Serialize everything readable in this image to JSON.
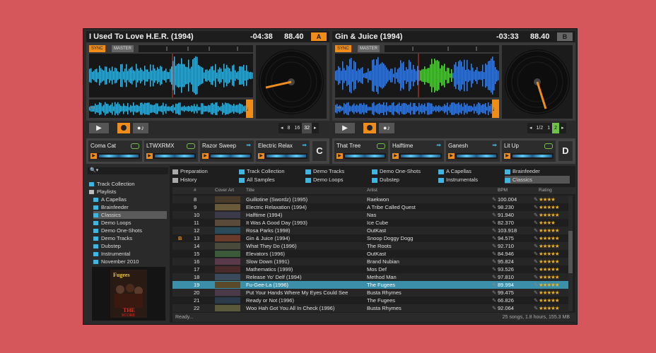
{
  "deckA": {
    "title": "I Used To Love H.E.R. (1994)",
    "time": "-04:38",
    "bpm": "88.40",
    "letter": "A",
    "sync": "SYNC",
    "master": "MASTER",
    "loops": [
      "8",
      "16",
      "32"
    ],
    "active_loop": "32",
    "play": "▶"
  },
  "deckB": {
    "title": "Gin & Juice (1994)",
    "time": "-03:33",
    "bpm": "88.40",
    "letter": "B",
    "sync": "SYNC",
    "master": "MASTER",
    "loops": [
      "1/2",
      "1",
      "2"
    ],
    "active_loop": "2",
    "play": "▶"
  },
  "fxA": {
    "slots": [
      "Coma Cat",
      "LTWXRMX",
      "Razor Sweep",
      "Electric Relax"
    ],
    "letter": "C"
  },
  "fxB": {
    "slots": [
      "That Tree",
      "Halftime",
      "Ganesh",
      "Lit Up"
    ],
    "letter": "D"
  },
  "tree": {
    "search": "🔍▾",
    "items": [
      {
        "label": "Track Collection",
        "icon": "track-collection-icon"
      },
      {
        "label": "Playlists",
        "icon": "folder-icon"
      },
      {
        "label": "A Capellas"
      },
      {
        "label": "Brainfeeder"
      },
      {
        "label": "Classics",
        "selected": true
      },
      {
        "label": "Demo Loops"
      },
      {
        "label": "Demo One-Shots"
      },
      {
        "label": "Demo Tracks"
      },
      {
        "label": "Dubstep"
      },
      {
        "label": "Instrumental"
      },
      {
        "label": "November 2010"
      }
    ]
  },
  "favorites": [
    {
      "label": "Preparation"
    },
    {
      "label": "Track Collection"
    },
    {
      "label": "Demo Tracks"
    },
    {
      "label": "Demo One-Shots"
    },
    {
      "label": "A Capellas"
    },
    {
      "label": "Brainfeeder"
    },
    {
      "label": "History"
    },
    {
      "label": "All Samples"
    },
    {
      "label": "Demo Loops"
    },
    {
      "label": "Dubstep"
    },
    {
      "label": "Instrumentals"
    },
    {
      "label": "Classics",
      "selected": true
    }
  ],
  "table": {
    "headers": {
      "num": "#",
      "cover": "Cover Art",
      "title": "Title",
      "artist": "Artist",
      "bpm": "BPM",
      "rating": "Rating"
    },
    "rows": [
      {
        "num": "8",
        "title": "Guillotine (Swordz) (1995)",
        "artist": "Raekwon",
        "bpm": "100.004",
        "rating": "★★★★"
      },
      {
        "num": "9",
        "title": "Electric Relaxation (1994)",
        "artist": "A Tribe Called Quest",
        "bpm": "98.230",
        "rating": "★★★★★"
      },
      {
        "num": "10",
        "title": "Halftime (1994)",
        "artist": "Nas",
        "bpm": "91.940",
        "rating": "★★★★★"
      },
      {
        "num": "11",
        "title": "It Was A Good Day (1993)",
        "artist": "Ice Cube",
        "bpm": "82.370",
        "rating": "★★★★"
      },
      {
        "num": "12",
        "title": "Rosa Parks (1998)",
        "artist": "OutKast",
        "bpm": "103.918",
        "rating": "★★★★★"
      },
      {
        "num": "13",
        "mark": "B",
        "title": "Gin & Juice (1994)",
        "artist": "Snoop Doggy Dogg",
        "bpm": "94.575",
        "rating": "★★★★★"
      },
      {
        "num": "14",
        "title": "What They Do (1996)",
        "artist": "The Roots",
        "bpm": "92.710",
        "rating": "★★★★★"
      },
      {
        "num": "15",
        "title": "Elevators (1996)",
        "artist": "OutKast",
        "bpm": "84.946",
        "rating": "★★★★★"
      },
      {
        "num": "16",
        "title": "Slow Down (1991)",
        "artist": "Brand Nubian",
        "bpm": "95.824",
        "rating": "★★★★★"
      },
      {
        "num": "17",
        "title": "Mathematics (1999)",
        "artist": "Mos Def",
        "bpm": "93.526",
        "rating": "★★★★★"
      },
      {
        "num": "18",
        "title": "Release Yo' Delf (1994)",
        "artist": "Method Man",
        "bpm": "97.810",
        "rating": "★★★★★"
      },
      {
        "num": "19",
        "title": "Fu-Gee-La (1996)",
        "artist": "The Fugees",
        "bpm": "89.994",
        "rating": "★★★★★",
        "selected": true
      },
      {
        "num": "20",
        "title": "Put Your Hands Where My Eyes Could See",
        "artist": "Busta Rhymes",
        "bpm": "99.475",
        "rating": "★★★★★"
      },
      {
        "num": "21",
        "title": "Ready or Not (1996)",
        "artist": "The Fugees",
        "bpm": "66.826",
        "rating": "★★★★★"
      },
      {
        "num": "22",
        "title": "Woo Hah Got You All In Check (1996)",
        "artist": "Busta Rhymes",
        "bpm": "92.064",
        "rating": "★★★★★"
      }
    ]
  },
  "status": {
    "left": "Ready...",
    "right": "25 songs, 1.8 hours, 155.3 MB"
  },
  "cover_album": "Fugees",
  "colors": {
    "accent": "#f08c1a",
    "wave_blue": "#3fb5e0",
    "green": "#6fc04a",
    "selection": "#3b8fa8"
  }
}
